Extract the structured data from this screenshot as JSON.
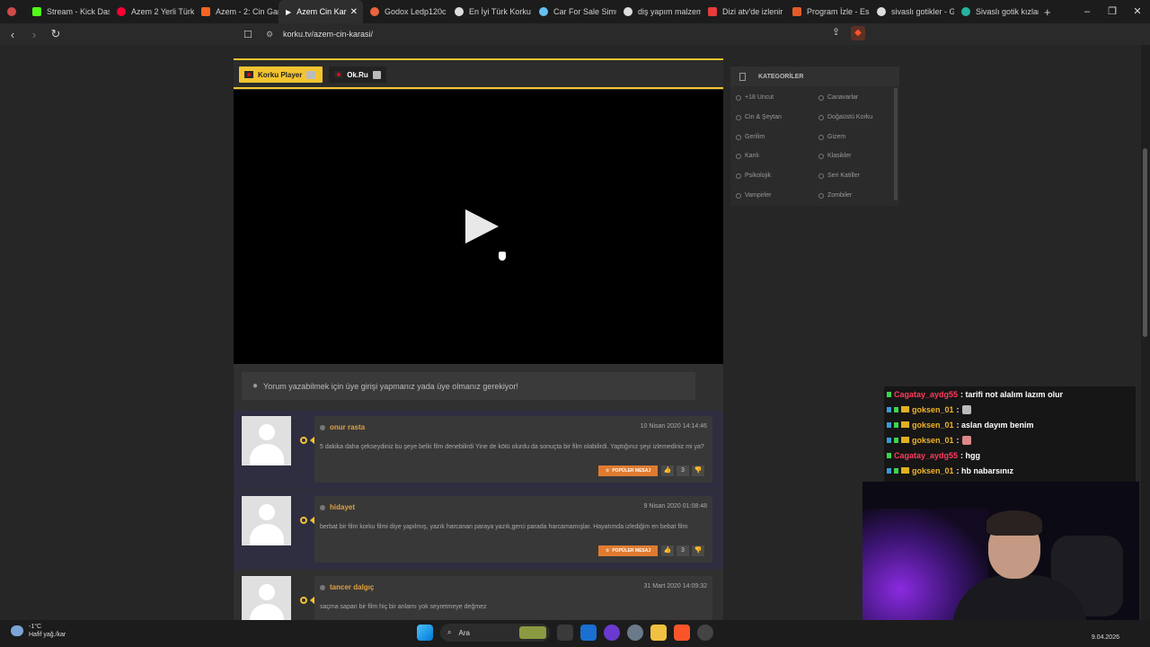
{
  "browser": {
    "tabs": [
      {
        "label": "",
        "color": "#d04a4a"
      },
      {
        "label": "Stream - Kick Dash",
        "color": "#53fc18"
      },
      {
        "label": "Azem 2 Yerli Türk K",
        "color": "#ff0033"
      },
      {
        "label": "Azem - 2: Cin Garo",
        "color": "#f26522"
      },
      {
        "label": "Azem Cin Kar",
        "color": "#ffffff",
        "active": true
      },
      {
        "label": "Godox Ledp120c V",
        "color": "#e8643c"
      },
      {
        "label": "En İyi Türk Korku F",
        "color": "#dddddd"
      },
      {
        "label": "Car For Sale Simula",
        "color": "#66c0f4"
      },
      {
        "label": "diş yapım malzemı",
        "color": "#dddddd"
      },
      {
        "label": "Dizi atv'de izlenir |",
        "color": "#e63c3c"
      },
      {
        "label": "Program İzle - Esra",
        "color": "#e35a2a"
      },
      {
        "label": "sivaslı gotikler - Go",
        "color": "#dddddd"
      },
      {
        "label": "Sivaslı gotik kızlarıı",
        "color": "#25b39e"
      }
    ],
    "new_tab": "+",
    "url": "korku.tv/azem-cin-karasi/",
    "window_controls": [
      "–",
      "❐",
      "✕"
    ]
  },
  "player": {
    "sources": [
      {
        "label": "Korku Player"
      },
      {
        "label": "Ok.Ru"
      }
    ]
  },
  "login_notice": "Yorum yazabilmek için üye girişi yapmanız yada üye olmanız gerekiyor!",
  "comments": [
    {
      "user": "onur rasta",
      "date": "10 Nisan 2020 14:14:46",
      "text": "5 dakika daha çekseydiniz bu şeye belki film denebilirdi Yine de kötü olurdu da sonuçta bir film olabilirdi. Yaptığınız şeyi izlemediniz mi ya?",
      "popular": "POPÜLER MESAJ",
      "votes": "3"
    },
    {
      "user": "hidayet",
      "date": "9 Nisan 2020 01:08:48",
      "text": "berbat bir film korku filmi diye yapılmış, yazık harcanan paraya yazık,gerci parada harcamamışlar. Hayatımda izlediğim en bebat film",
      "popular": "POPÜLER MESAJ",
      "votes": "3"
    },
    {
      "user": "tancer dalgıç",
      "date": "31 Mart 2020 14:09:32",
      "text": "saçma sapan bir film hiç bir anlamı yok seyretmeye değmez",
      "popular": "",
      "votes": ""
    }
  ],
  "sidebar": {
    "title": "KATEGORİLER",
    "categories": [
      "+18 Uncut",
      "Canavarlar",
      "Cin & Şeytan",
      "Doğaüstü Korku",
      "Gerilim",
      "Gizem",
      "Kanlı",
      "Klasikler",
      "Psikolojik",
      "Seri Katiller",
      "Vampirler",
      "Zombiler"
    ]
  },
  "chat": [
    {
      "user": "Cagatay_aydg55",
      "msg": ": tarifi not alalım lazım olur",
      "color": "#ff3b5c"
    },
    {
      "user": "goksen_01",
      "msg": ":",
      "color": "#f0b429"
    },
    {
      "user": "goksen_01",
      "msg": ": aslan dayım benim",
      "color": "#f0b429"
    },
    {
      "user": "goksen_01",
      "msg": ":",
      "color": "#f0b429"
    },
    {
      "user": "Cagatay_aydg55",
      "msg": ": hgg",
      "color": "#ff3b5c"
    },
    {
      "user": "goksen_01",
      "msg": ": hb nabarsınız",
      "color": "#f0b429"
    }
  ],
  "taskbar": {
    "temperature": "-1°C",
    "weather": "Hafif yağ./kar",
    "search": "Ara",
    "date": "9.04.2026"
  },
  "colors": {
    "accent": "#f4c430",
    "popular": "#e07b30",
    "username": "#e0a040"
  }
}
